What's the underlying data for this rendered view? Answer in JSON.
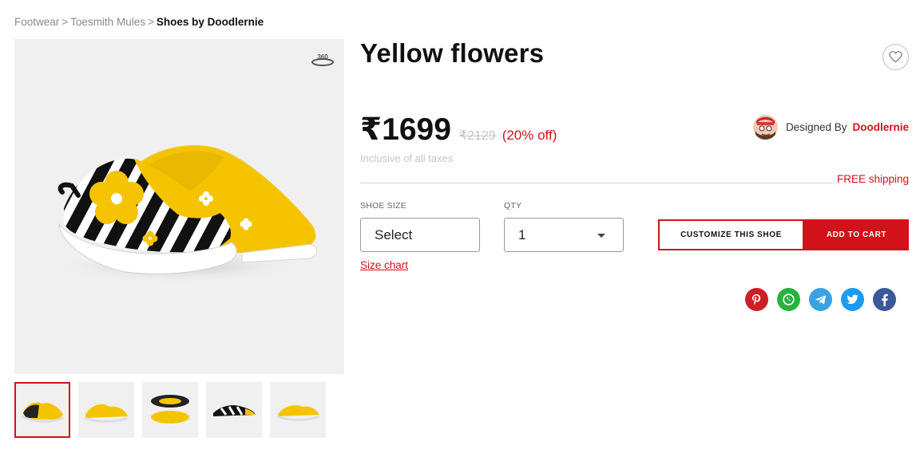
{
  "breadcrumb": {
    "items": [
      "Footwear",
      "Toesmith Mules",
      "Shoes by Doodlernie"
    ],
    "separator": ">"
  },
  "product": {
    "title": "Yellow flowers",
    "price": "₹1699",
    "mrp": "₹2129",
    "discount": "(20% off)",
    "taxes_note": "Inclusive of all taxes",
    "free_shipping": "FREE shipping"
  },
  "designer": {
    "prefix": "Designed By",
    "name": "Doodlernie"
  },
  "options": {
    "size_label": "SHOE SIZE",
    "size_value": "Select",
    "qty_label": "QTY",
    "qty_value": "1",
    "size_chart": "Size chart"
  },
  "actions": {
    "customize": "CUSTOMIZE THIS SHOE",
    "add_to_cart": "ADD TO CART"
  },
  "gallery": {
    "badge": "360",
    "thumbnail_count": 5,
    "active_thumbnail": 1
  },
  "share_icons": [
    "pinterest-icon",
    "whatsapp-icon",
    "telegram-icon",
    "twitter-icon",
    "facebook-icon"
  ],
  "colors": {
    "accent": "#d0131a",
    "shoe_yellow": "#f5c400",
    "pinterest": "#cb2027",
    "whatsapp": "#25b33c",
    "telegram": "#3aa2e0",
    "twitter": "#1d9bf0",
    "facebook": "#3b5998"
  }
}
